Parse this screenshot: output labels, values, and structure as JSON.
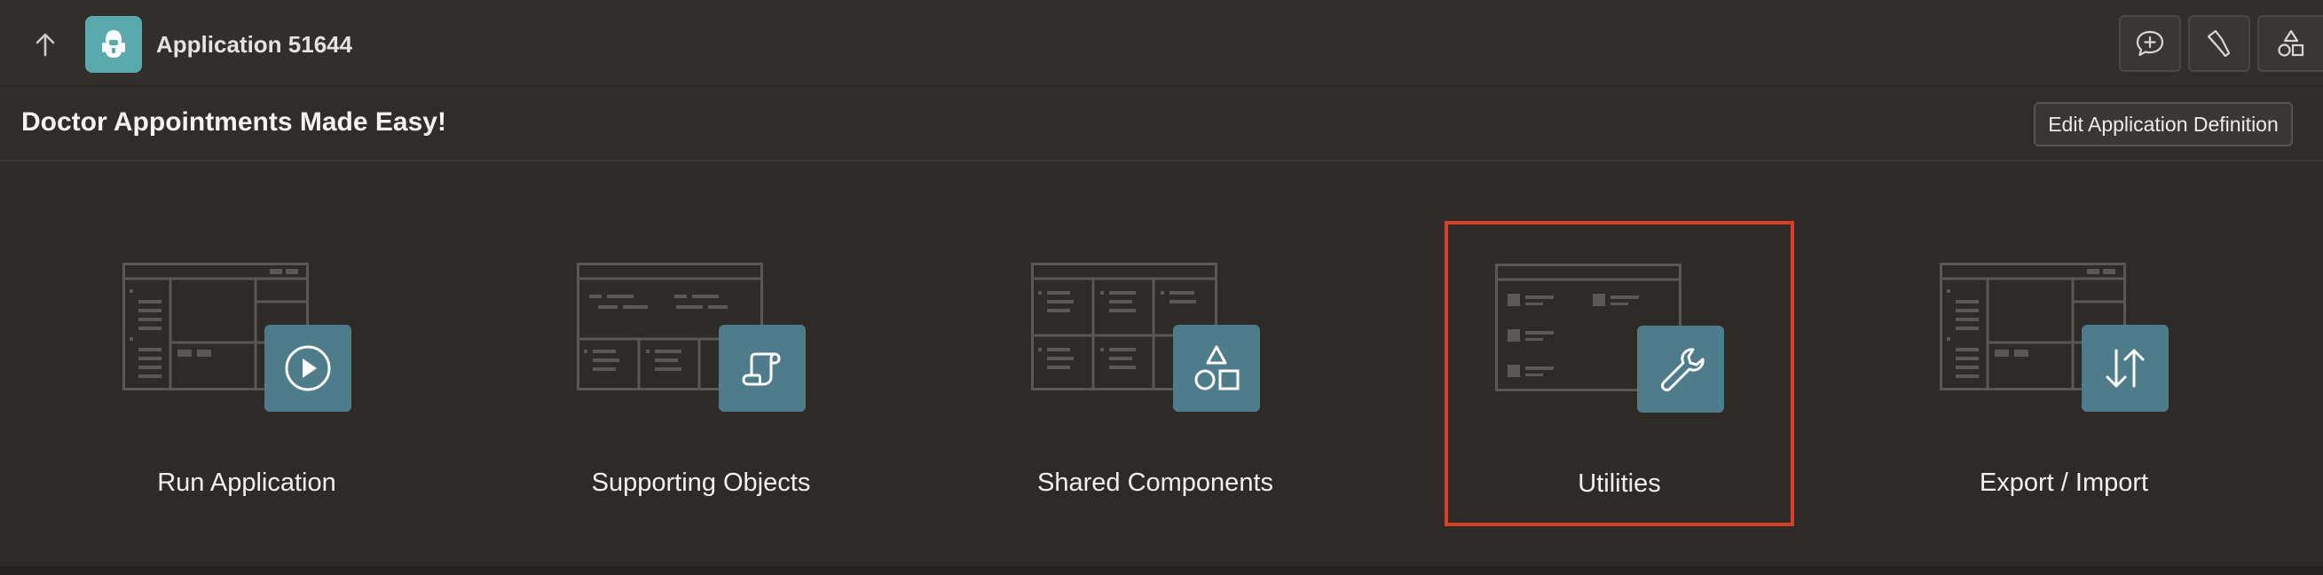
{
  "topbar": {
    "app_title": "Application 51644",
    "icons": {
      "up": "arrow-up-icon",
      "app": "app-robot-icon",
      "feedback": "chat-plus-icon",
      "search": "flashlight-icon",
      "shapes": "shapes-icon"
    }
  },
  "header": {
    "title": "Doctor Appointments Made Easy!",
    "edit_label": "Edit Application Definition"
  },
  "tiles": [
    {
      "label": "Run Application",
      "icon": "play-icon"
    },
    {
      "label": "Supporting Objects",
      "icon": "scroll-icon"
    },
    {
      "label": "Shared Components",
      "icon": "shapes-icon"
    },
    {
      "label": "Utilities",
      "icon": "wrench-icon",
      "selected": true
    },
    {
      "label": "Export / Import",
      "icon": "arrows-up-down-icon"
    }
  ],
  "colors": {
    "background": "#2f2c29",
    "badge": "#4f7c8a",
    "app_icon": "#5aa9ad",
    "selection": "#d9402a"
  }
}
